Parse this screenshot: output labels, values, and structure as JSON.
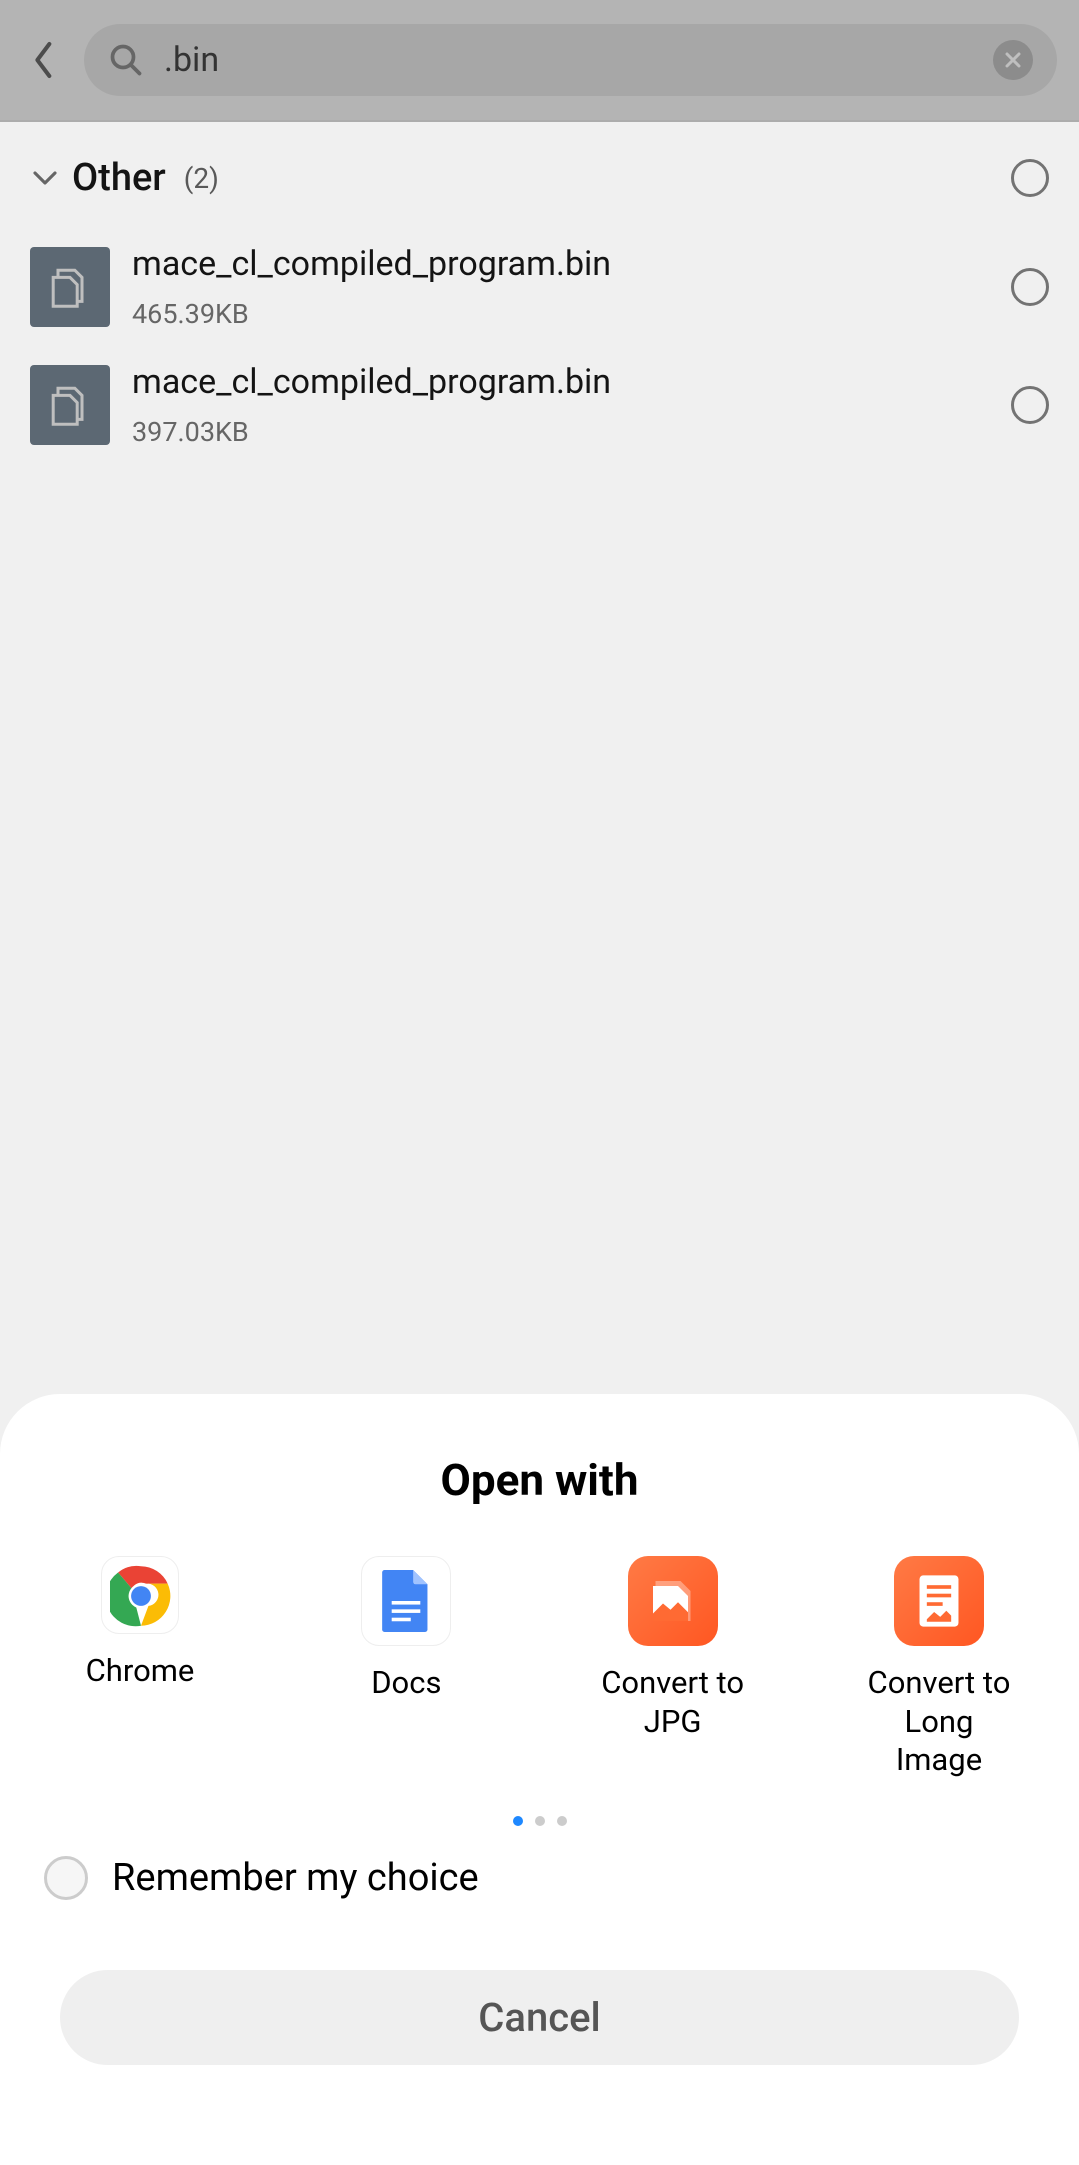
{
  "search": {
    "query": ".bin"
  },
  "section": {
    "title": "Other",
    "count": "(2)"
  },
  "files": [
    {
      "name": "mace_cl_compiled_program.bin",
      "size": "465.39KB"
    },
    {
      "name": "mace_cl_compiled_program.bin",
      "size": "397.03KB"
    }
  ],
  "sheet": {
    "title": "Open with",
    "apps": [
      {
        "label": "Chrome"
      },
      {
        "label": "Docs"
      },
      {
        "label": "Convert to JPG"
      },
      {
        "label": "Convert to Long Image"
      }
    ],
    "remember_label": "Remember my choice",
    "cancel_label": "Cancel"
  }
}
